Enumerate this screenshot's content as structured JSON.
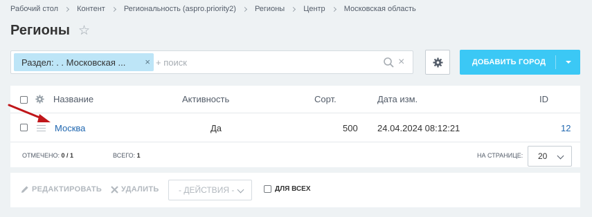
{
  "breadcrumb": [
    "Рабочий стол",
    "Контент",
    "Региональность (aspro.priority2)",
    "Регионы",
    "Центр",
    "Московская область"
  ],
  "page": {
    "title": "Регионы"
  },
  "filter": {
    "chip_label": "Раздел: . . Московская ...",
    "chip_close": "×",
    "search_placeholder": "+ поиск",
    "clear": "×"
  },
  "toolbar": {
    "add_label": "ДОБАВИТЬ ГОРОД"
  },
  "grid": {
    "columns": {
      "name": "Название",
      "active": "Активность",
      "sort": "Сорт.",
      "date": "Дата изм.",
      "id": "ID"
    },
    "rows": [
      {
        "name": "Москва",
        "active": "Да",
        "sort": "500",
        "date": "24.04.2024 08:12:21",
        "id": "12"
      }
    ],
    "footer": {
      "selected_label": "ОТМЕЧЕНО:",
      "selected_value": "0 / 1",
      "total_label": "ВСЕГО:",
      "total_value": "1",
      "per_page_label": "НА СТРАНИЦЕ:",
      "per_page_value": "20"
    }
  },
  "actions": {
    "edit": "РЕДАКТИРОВАТЬ",
    "delete": "УДАЛИТЬ",
    "select_placeholder": "- ДЕЙСТВИЯ -",
    "for_all": "ДЛЯ ВСЕХ"
  },
  "colors": {
    "accent": "#3bc8f5",
    "chip": "#bde5f7",
    "link": "#2067b0",
    "arrow": "#c0161a"
  }
}
